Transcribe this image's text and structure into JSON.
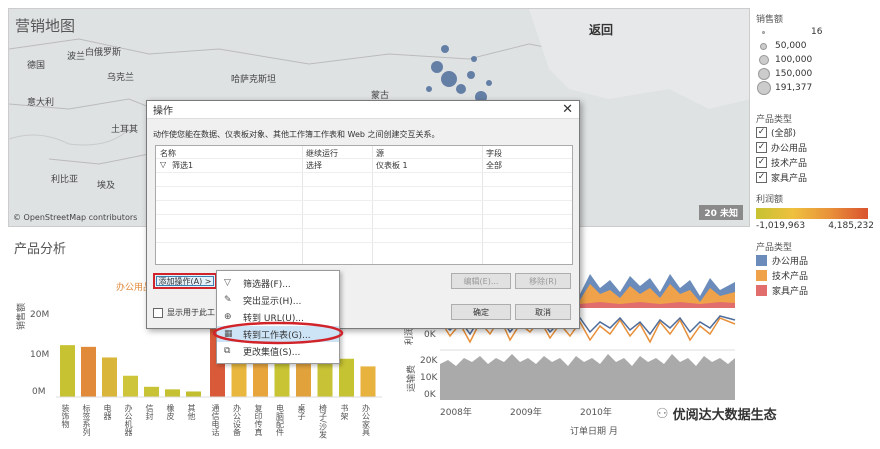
{
  "map": {
    "title": "营销地图",
    "back": "返回",
    "attribution": "© OpenStreetMap contributors",
    "unknown_badge": "20 未知",
    "labels": [
      {
        "text": "波兰",
        "name": "map-label-poland"
      },
      {
        "text": "白俄罗斯",
        "name": "map-label-belarus"
      },
      {
        "text": "德国",
        "name": "map-label-germany"
      },
      {
        "text": "乌克兰",
        "name": "map-label-ukraine"
      },
      {
        "text": "哈萨克斯坦",
        "name": "map-label-kazakhstan"
      },
      {
        "text": "蒙古",
        "name": "map-label-mongolia"
      },
      {
        "text": "意大利",
        "name": "map-label-italy"
      },
      {
        "text": "土耳其",
        "name": "map-label-turkey"
      },
      {
        "text": "利比亚",
        "name": "map-label-libya"
      },
      {
        "text": "埃及",
        "name": "map-label-egypt"
      }
    ]
  },
  "legend": {
    "sales_title": "销售额",
    "sizes": [
      "16",
      "50,000",
      "100,000",
      "150,000",
      "191,377"
    ],
    "category_title": "产品类型",
    "categories": [
      "(全部)",
      "办公用品",
      "技术产品",
      "家具产品"
    ],
    "profit_title": "利润额",
    "profit_min": "-1,019,963",
    "profit_max": "4,185,232",
    "type_title": "产品类型",
    "types": [
      {
        "label": "办公用品",
        "color": "#6b8cba"
      },
      {
        "label": "技术产品",
        "color": "#f0a24a"
      },
      {
        "label": "家具产品",
        "color": "#e26d6d"
      }
    ]
  },
  "dialog": {
    "title": "操作",
    "close": "✕",
    "description": "动作使您能在数据、仪表板对象、其他工作簿工作表和 Web 之间创建交互关系。",
    "headers": [
      "名称",
      "继续运行",
      "源",
      "字段"
    ],
    "row": {
      "icon": "▽",
      "name": "筛选1",
      "run": "选择",
      "source": "仪表板 1",
      "field": "全部"
    },
    "add_action": "添加操作(A) >",
    "edit": "编辑(E)...",
    "remove": "移除(R)",
    "show_in_menu": "显示用于此工",
    "ok": "确定",
    "cancel": "取消"
  },
  "menu": [
    {
      "icon": "▽",
      "label": "筛选器(F)..."
    },
    {
      "icon": "✎",
      "label": "突出显示(H)..."
    },
    {
      "icon": "⊕",
      "label": "转到 URL(U)..."
    },
    {
      "icon": "▦",
      "label": "转到工作表(G)..."
    },
    {
      "icon": "⧉",
      "label": "更改集值(S)..."
    }
  ],
  "analysis": {
    "title": "产品分析",
    "header": "办公用品",
    "y_label": "销售额",
    "y_ticks": [
      "20M",
      "10M",
      "0M"
    ],
    "categories_left": [
      "装饰物",
      "标签系列",
      "电器",
      "办公机器",
      "信封",
      "橡皮",
      "其他"
    ],
    "categories_right": [
      "通信电话",
      "办公设备",
      "复印传真",
      "电脑配件",
      "桌子",
      "椅子/沙发",
      "书架",
      "办公家具"
    ],
    "bar_values_left": [
      12.2,
      11.8,
      9.3,
      5.0,
      2.4,
      1.8,
      1.3
    ],
    "bar_values_right": [
      18.5,
      13.8,
      16.2,
      12.8,
      14.0,
      10.2,
      9.0,
      7.2
    ],
    "bar_colors_left": [
      "#c6c232",
      "#e08a3a",
      "#d9b53a",
      "#cfc53a",
      "#c8c336",
      "#c5c132",
      "#c2be30"
    ],
    "bar_colors_right": [
      "#d85a38",
      "#e9b73e",
      "#e7a53c",
      "#c9c434",
      "#e1a23c",
      "#c8c336",
      "#c6c333",
      "#e8b23f"
    ]
  },
  "timeline": {
    "y_profit": "利润",
    "y_ship": "运输费",
    "ticks_profit": [
      "0K"
    ],
    "ticks_ship": [
      "20K",
      "10K",
      "0K"
    ],
    "years": [
      "2008年",
      "2009年",
      "2010年"
    ],
    "x_label": "订单日期 月"
  },
  "watermark": "优阅达大数据生态"
}
